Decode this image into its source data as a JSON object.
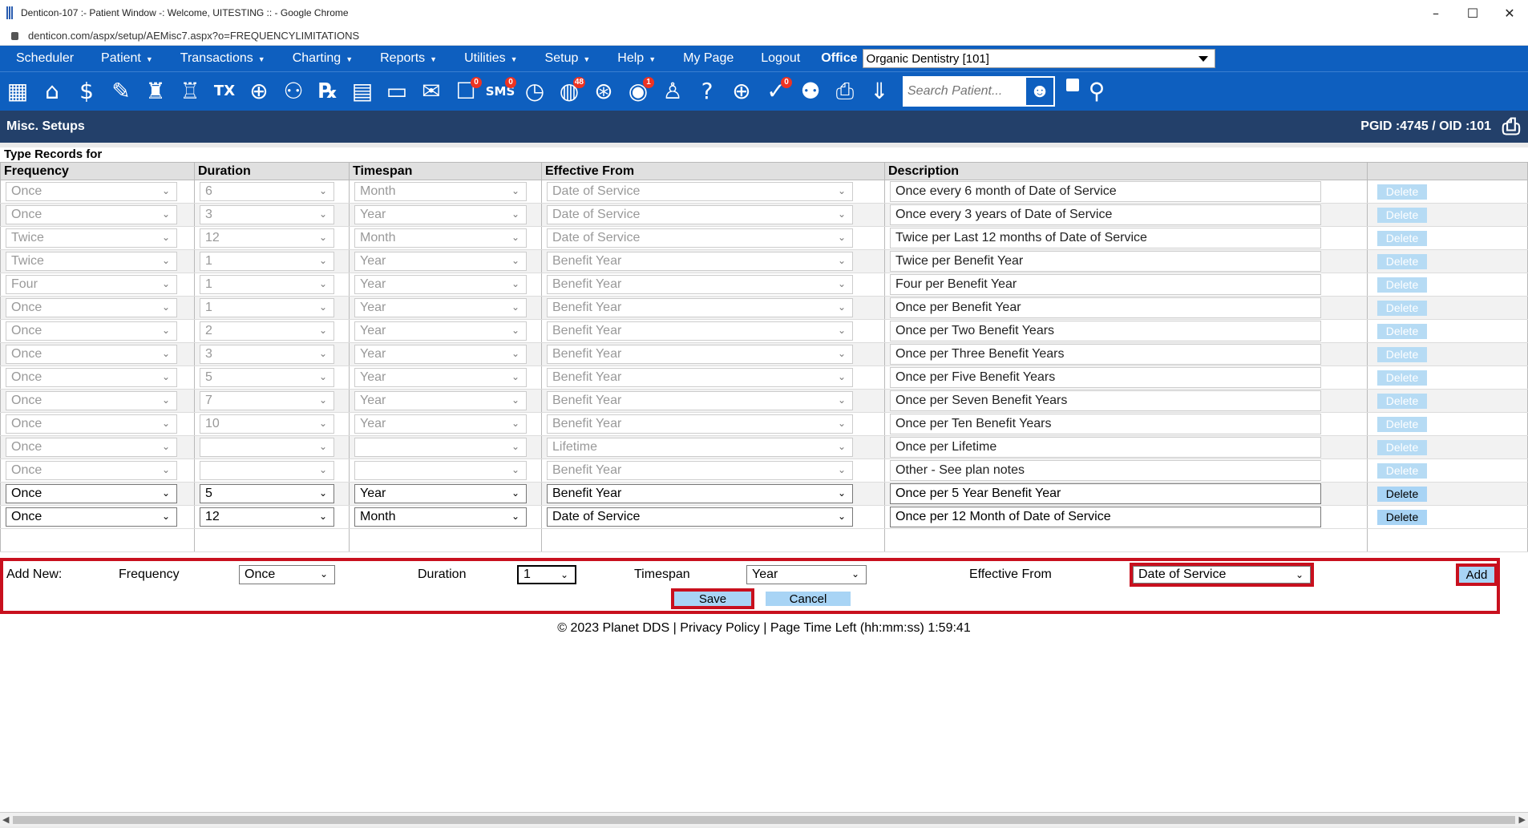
{
  "window": {
    "title": "Denticon-107 :- Patient Window -: Welcome, UITESTING :: - Google Chrome",
    "minimize": "–",
    "maximize": "☐",
    "close": "✕"
  },
  "url": "denticon.com/aspx/setup/AEMisc7.aspx?o=FREQUENCYLIMITATIONS",
  "menu": {
    "items": [
      {
        "label": "Scheduler",
        "caret": false
      },
      {
        "label": "Patient",
        "caret": true
      },
      {
        "label": "Transactions",
        "caret": true
      },
      {
        "label": "Charting",
        "caret": true
      },
      {
        "label": "Reports",
        "caret": true
      },
      {
        "label": "Utilities",
        "caret": true
      },
      {
        "label": "Setup",
        "caret": true
      },
      {
        "label": "Help",
        "caret": true
      },
      {
        "label": "My Page",
        "caret": false
      },
      {
        "label": "Logout",
        "caret": false
      }
    ],
    "office_label": "Office",
    "office_value": "Organic Dentistry [101]"
  },
  "toolbar": {
    "badges": {
      "messages": "0",
      "sms": "0",
      "globe": "48",
      "alerts": "1",
      "tasks": "0"
    },
    "sms_text": "SMS",
    "search_placeholder": "Search Patient..."
  },
  "section": {
    "title": "Misc. Setups",
    "ids": "PGID :4745  /  OID :101"
  },
  "table": {
    "caption": "Type Records for",
    "headers": [
      "Frequency",
      "Duration",
      "Timespan",
      "Effective From",
      "Description",
      ""
    ],
    "delete_label": "Delete",
    "rows": [
      {
        "frequency": "Once",
        "duration": "6",
        "timespan": "Month",
        "effective": "Date of Service",
        "description": "Once every 6 month of Date of Service",
        "active": false
      },
      {
        "frequency": "Once",
        "duration": "3",
        "timespan": "Year",
        "effective": "Date of Service",
        "description": "Once every 3 years of Date of Service",
        "active": false
      },
      {
        "frequency": "Twice",
        "duration": "12",
        "timespan": "Month",
        "effective": "Date of Service",
        "description": "Twice per Last 12 months of Date of Service",
        "active": false
      },
      {
        "frequency": "Twice",
        "duration": "1",
        "timespan": "Year",
        "effective": "Benefit Year",
        "description": "Twice per Benefit Year",
        "active": false
      },
      {
        "frequency": "Four",
        "duration": "1",
        "timespan": "Year",
        "effective": "Benefit Year",
        "description": "Four per Benefit Year",
        "active": false
      },
      {
        "frequency": "Once",
        "duration": "1",
        "timespan": "Year",
        "effective": "Benefit Year",
        "description": "Once per Benefit Year",
        "active": false
      },
      {
        "frequency": "Once",
        "duration": "2",
        "timespan": "Year",
        "effective": "Benefit Year",
        "description": "Once per Two Benefit Years",
        "active": false
      },
      {
        "frequency": "Once",
        "duration": "3",
        "timespan": "Year",
        "effective": "Benefit Year",
        "description": "Once per Three Benefit Years",
        "active": false
      },
      {
        "frequency": "Once",
        "duration": "5",
        "timespan": "Year",
        "effective": "Benefit Year",
        "description": "Once per Five Benefit Years",
        "active": false
      },
      {
        "frequency": "Once",
        "duration": "7",
        "timespan": "Year",
        "effective": "Benefit Year",
        "description": "Once per Seven Benefit Years",
        "active": false
      },
      {
        "frequency": "Once",
        "duration": "10",
        "timespan": "Year",
        "effective": "Benefit Year",
        "description": "Once per Ten Benefit Years",
        "active": false
      },
      {
        "frequency": "Once",
        "duration": "",
        "timespan": "",
        "effective": "Lifetime",
        "description": "Once per Lifetime",
        "active": false
      },
      {
        "frequency": "Once",
        "duration": "",
        "timespan": "",
        "effective": "Benefit Year",
        "description": "Other - See plan notes",
        "active": false
      },
      {
        "frequency": "Once",
        "duration": "5",
        "timespan": "Year",
        "effective": "Benefit Year",
        "description": "Once per 5 Year Benefit Year",
        "active": true
      },
      {
        "frequency": "Once",
        "duration": "12",
        "timespan": "Month",
        "effective": "Date of Service",
        "description": "Once per 12 Month of Date of Service",
        "active": true
      }
    ]
  },
  "add_new": {
    "label": "Add New:",
    "frequency_label": "Frequency",
    "frequency_value": "Once",
    "duration_label": "Duration",
    "duration_value": "1",
    "timespan_label": "Timespan",
    "timespan_value": "Year",
    "effective_label": "Effective From",
    "effective_value": "Date of Service",
    "add_label": "Add",
    "save_label": "Save",
    "cancel_label": "Cancel"
  },
  "footer": {
    "copyright": "© 2023 Planet DDS |",
    "privacy": "Privacy Policy",
    "time_left": "|  Page Time Left (hh:mm:ss) 1:59:41"
  },
  "colors": {
    "brand_blue": "#0e5fbf",
    "header_navy": "#23406a",
    "highlight_red": "#c8101e",
    "button_blue": "#a8d4f5"
  }
}
